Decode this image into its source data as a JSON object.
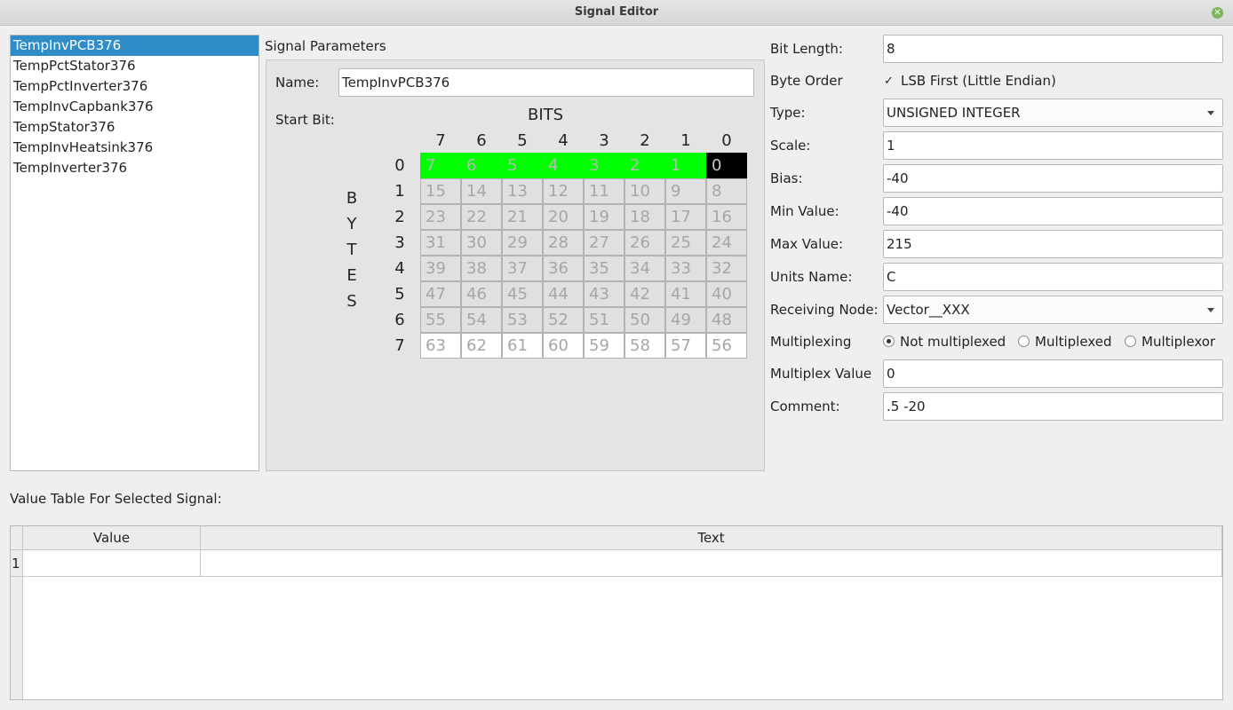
{
  "window": {
    "title": "Signal Editor",
    "close_glyph": "✕",
    "close_icon": "close-icon"
  },
  "signal_list": [
    "TempInvPCB376",
    "TempPctStator376",
    "TempPctInverter376",
    "TempInvCapbank376",
    "TempStator376",
    "TempInvHeatsink376",
    "TempInverter376"
  ],
  "signal_list_selected": "TempInvPCB376",
  "signal_params": {
    "title": "Signal Parameters",
    "name_label": "Name:",
    "name_value": "TempInvPCB376",
    "start_bit_label": "Start Bit:",
    "bits_label": "BITS",
    "bytes_label": [
      "B",
      "Y",
      "T",
      "E",
      "S"
    ],
    "bit_headers": [
      "7",
      "6",
      "5",
      "4",
      "3",
      "2",
      "1",
      "0"
    ],
    "byte_headers": [
      "0",
      "1",
      "2",
      "3",
      "4",
      "5",
      "6",
      "7"
    ],
    "grid": [
      [
        "7",
        "6",
        "5",
        "4",
        "3",
        "2",
        "1",
        "0"
      ],
      [
        "15",
        "14",
        "13",
        "12",
        "11",
        "10",
        "9",
        "8"
      ],
      [
        "23",
        "22",
        "21",
        "20",
        "19",
        "18",
        "17",
        "16"
      ],
      [
        "31",
        "30",
        "29",
        "28",
        "27",
        "26",
        "25",
        "24"
      ],
      [
        "39",
        "38",
        "37",
        "36",
        "35",
        "34",
        "33",
        "32"
      ],
      [
        "47",
        "46",
        "45",
        "44",
        "43",
        "42",
        "41",
        "40"
      ],
      [
        "55",
        "54",
        "53",
        "52",
        "51",
        "50",
        "49",
        "48"
      ],
      [
        "63",
        "62",
        "61",
        "60",
        "59",
        "58",
        "57",
        "56"
      ]
    ],
    "highlight_bits": [
      "7",
      "6",
      "5",
      "4",
      "3",
      "2",
      "1"
    ],
    "start_bit": "0",
    "colors": {
      "used": "#00ff00",
      "start": "#000000",
      "normal": "#e0e0e0",
      "last_row": "#ffffff"
    }
  },
  "right": {
    "bit_length_label": "Bit Length:",
    "bit_length": "8",
    "byte_order_label": "Byte Order",
    "byte_order_checkbox": "LSB First (Little Endian)",
    "byte_order_checked_glyph": "✓",
    "type_label": "Type:",
    "type_value": "UNSIGNED INTEGER",
    "scale_label": "Scale:",
    "scale": "1",
    "bias_label": "Bias:",
    "bias": "-40",
    "min_label": "Min Value:",
    "min": "-40",
    "max_label": "Max Value:",
    "max": "215",
    "units_label": "Units Name:",
    "units": "C",
    "receiving_label": "Receiving Node:",
    "receiving": "Vector__XXX",
    "mux_label": "Multiplexing",
    "mux_options": [
      "Not multiplexed",
      "Multiplexed",
      "Multiplexor"
    ],
    "mux_selected": "Not multiplexed",
    "mux_value_label": "Multiplex Value",
    "mux_value": "0",
    "comment_label": "Comment:",
    "comment": ".5 -20"
  },
  "value_table": {
    "label": "Value Table For Selected Signal:",
    "headers": [
      "Value",
      "Text"
    ],
    "row_numbers": [
      "1"
    ]
  }
}
